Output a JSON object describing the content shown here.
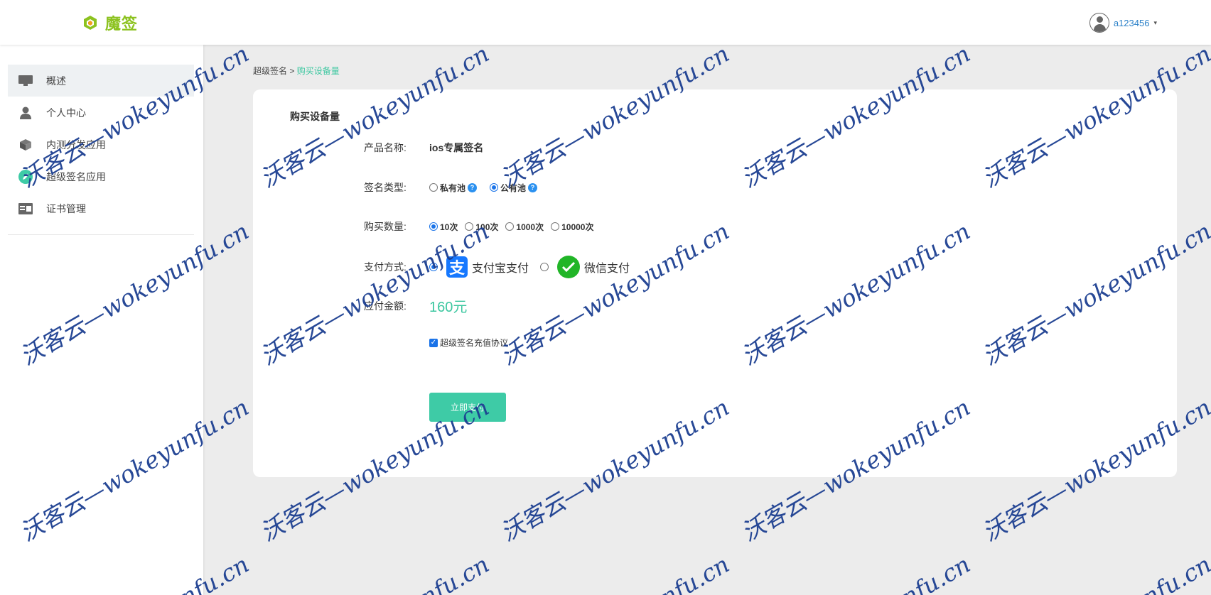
{
  "header": {
    "logo_text": "魔签",
    "username": "a123456",
    "caret": "▾",
    "brand_color": "#8cc21f"
  },
  "sidebar": {
    "items": [
      {
        "label": "概述",
        "icon": "monitor-icon",
        "active": true
      },
      {
        "label": "个人中心",
        "icon": "user-icon",
        "active": false
      },
      {
        "label": "内测分发应用",
        "icon": "box-icon",
        "active": false
      },
      {
        "label": "超级签名应用",
        "icon": "pencil-icon",
        "active": false
      },
      {
        "label": "证书管理",
        "icon": "certificate-icon",
        "active": false
      }
    ]
  },
  "breadcrumb": {
    "parent": "超级签名",
    "separator": ">",
    "current": "购买设备量"
  },
  "form": {
    "title": "购买设备量",
    "product_label": "产品名称:",
    "product_value": "ios专属签名",
    "sign_type_label": "签名类型:",
    "sign_types": [
      {
        "label": "私有池",
        "selected": false
      },
      {
        "label": "公有池",
        "selected": true
      }
    ],
    "qty_label": "购买数量:",
    "quantities": [
      {
        "label": "10次",
        "selected": true
      },
      {
        "label": "100次",
        "selected": false
      },
      {
        "label": "1000次",
        "selected": false
      },
      {
        "label": "10000次",
        "selected": false
      }
    ],
    "pay_label": "支付方式:",
    "pay_methods": [
      {
        "label": "支付宝支付",
        "icon": "alipay-icon",
        "glyph": "支",
        "selected": true
      },
      {
        "label": "微信支付",
        "icon": "wechat-pay-icon",
        "selected": false
      }
    ],
    "amount_label": "应付金额:",
    "amount_value": "160元",
    "agreement": "超级签名充值协议",
    "agreement_checked": true,
    "submit_label": "立即支付",
    "accent_color": "#3ecba6"
  },
  "watermark": {
    "text": "沃客云—wokeyunfu.cn",
    "partial_text": "unfu.cn",
    "color": "#1c3f91"
  }
}
